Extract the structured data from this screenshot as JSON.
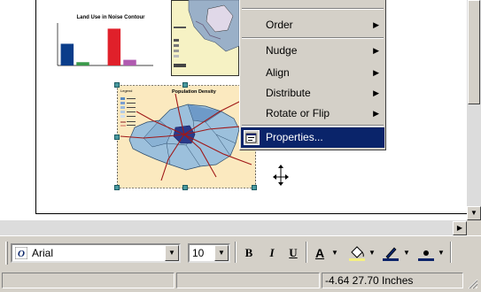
{
  "layout": {
    "chart_frame": {
      "title": "Land Use in Noise Contour",
      "y_ticks": [
        "",
        "",
        "",
        "",
        "",
        "",
        ""
      ],
      "x_ticks": [
        "",
        "",
        "",
        "",
        "",
        ""
      ]
    },
    "map_frame": {
      "title": "Population Density",
      "legend_title": "Legend"
    }
  },
  "chart_data": {
    "type": "bar",
    "title": "Land Use in Noise Contour",
    "categories": [
      "",
      "",
      "",
      "",
      "",
      ""
    ],
    "values": [
      230,
      35,
      0,
      390,
      60,
      0
    ],
    "colors": [
      "#0a3d8a",
      "#3a9a4a",
      "#d0d0d0",
      "#e0202a",
      "#b05ab0",
      "#888888"
    ],
    "ylim": [
      0,
      450
    ]
  },
  "context_menu": {
    "items": [
      {
        "label": "Order",
        "submenu": true
      },
      {
        "label": "Nudge",
        "submenu": true
      },
      {
        "label": "Align",
        "submenu": true
      },
      {
        "label": "Distribute",
        "submenu": true
      },
      {
        "label": "Rotate or Flip",
        "submenu": true
      },
      {
        "label": "Properties...",
        "submenu": false,
        "highlighted": true
      }
    ],
    "highlight_color": "#0a246a"
  },
  "toolbar": {
    "font_name": "Arial",
    "font_size": "10",
    "bold_label": "B",
    "italic_label": "I",
    "underline_label": "U",
    "font_color_label": "A"
  },
  "statusbar": {
    "coordinates": "-4.64  27.70 Inches"
  }
}
